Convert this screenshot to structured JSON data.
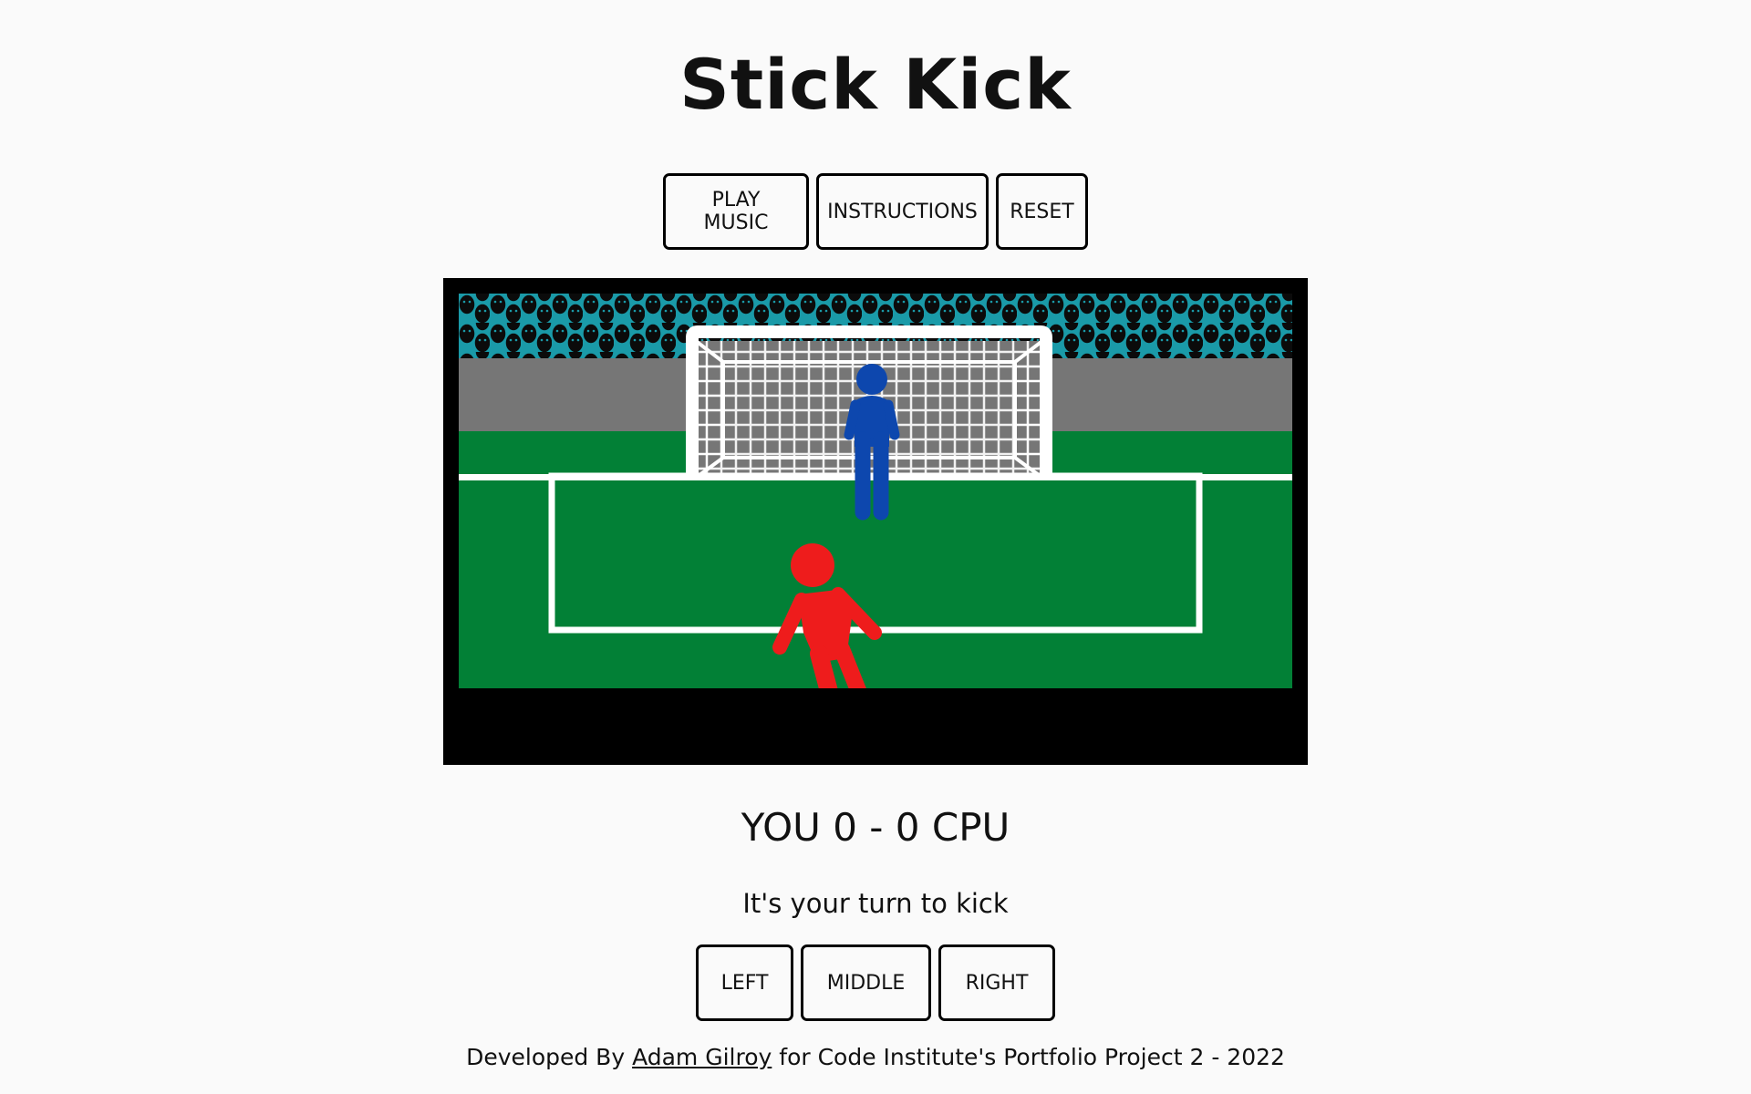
{
  "title": "Stick Kick",
  "controls": {
    "play_music_label": "PLAY MUSIC",
    "instructions_label": "INSTRUCTIONS",
    "reset_label": "RESET"
  },
  "scoreboard": {
    "text": "YOU 0 - 0 CPU",
    "player_label": "YOU",
    "player_score": 0,
    "cpu_score": 0,
    "cpu_label": "CPU"
  },
  "status_message": "It's your turn to kick",
  "kick_options": {
    "left_label": "LEFT",
    "middle_label": "MIDDLE",
    "right_label": "RIGHT"
  },
  "footer": {
    "prefix": "Developed By",
    "author": "Adam Gilroy",
    "suffix": "for Code Institute's Portfolio Project 2 - 2022"
  },
  "colors": {
    "background": "#fafafa",
    "pitch": "#028036",
    "crowd": "#1a9aa8",
    "stand": "#767676",
    "player": "#ee1c1c",
    "keeper": "#0d47ae"
  }
}
